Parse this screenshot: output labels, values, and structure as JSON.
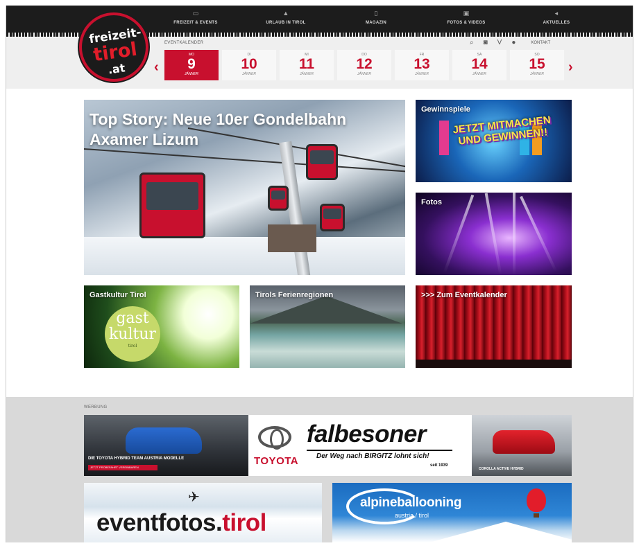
{
  "nav": {
    "items": [
      {
        "label": "FREIZEIT & EVENTS",
        "icon": "calendar-icon"
      },
      {
        "label": "URLAUB IN TIROL",
        "icon": "mountain-icon"
      },
      {
        "label": "MAGAZIN",
        "icon": "magazine-icon"
      },
      {
        "label": "FOTOS & VIDEOS",
        "icon": "photo-icon"
      },
      {
        "label": "AKTUELLES",
        "icon": "megaphone-icon"
      }
    ]
  },
  "logo": {
    "line1": "freizeit-",
    "line2": "tirol",
    "line3": ".at"
  },
  "calendar": {
    "label": "EVENTKALENDER",
    "days": [
      {
        "weekday": "MO",
        "day": "9",
        "month": "JÄNNER",
        "active": true
      },
      {
        "weekday": "DI",
        "day": "10",
        "month": "JÄNNER"
      },
      {
        "weekday": "MI",
        "day": "11",
        "month": "JÄNNER"
      },
      {
        "weekday": "DO",
        "day": "12",
        "month": "JÄNNER"
      },
      {
        "weekday": "FR",
        "day": "13",
        "month": "JÄNNER"
      },
      {
        "weekday": "SA",
        "day": "14",
        "month": "JÄNNER"
      },
      {
        "weekday": "SO",
        "day": "15",
        "month": "JÄNNER"
      }
    ],
    "prev": "‹",
    "next": "›"
  },
  "tools": {
    "kontakt": "KONTAKT"
  },
  "tiles": {
    "top_story": "Top Story: Neue 10er Gondelbahn Axamer Lizum",
    "gewinnspiele": "Gewinnspiele",
    "gewinnspiele_art": "JETZT MITMACHEN UND GEWINNEN!!",
    "fotos": "Fotos",
    "gastkultur": "Gastkultur Tirol",
    "gast_badge": {
      "l1": "gast",
      "l2": "kultur",
      "l3": "tirol"
    },
    "ferienregionen": "Tirols Ferienregionen",
    "eventkalender": ">>> Zum Eventkalender"
  },
  "ads": {
    "label": "WERBUNG",
    "toyota": {
      "caption_left": "DIE TOYOTA HYBRID TEAM AUSTRIA MODELLE",
      "cta_left": "JETZT PROBEFAHRT VEREINBAREN",
      "brand": "TOYOTA",
      "dealer": "falbesoner",
      "tagline": "Der Weg nach BIRGITZ lohnt sich!",
      "since": "seit 1939",
      "caption_right": "COROLLA ACTIVE HYBRID"
    },
    "eventfotos": {
      "name": "eventfotos.",
      "tld": "tirol"
    },
    "alpine": {
      "brand": "alpineballooning",
      "sub": "austria / tirol"
    }
  }
}
